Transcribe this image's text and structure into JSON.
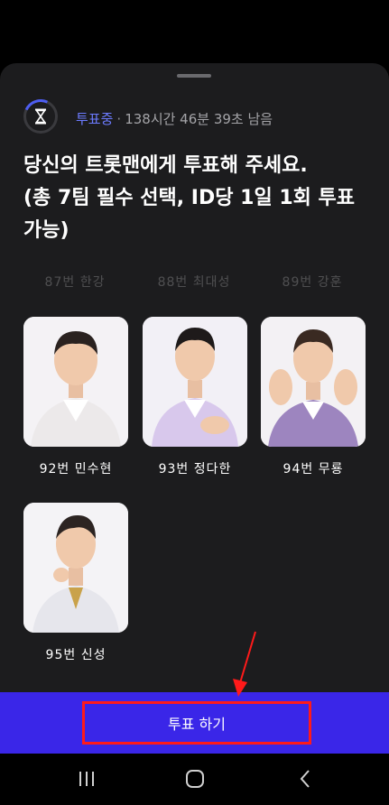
{
  "status": {
    "label": "투표중",
    "separator": "·",
    "remaining": "138시간 46분 39초 남음"
  },
  "title": "당신의 트롯맨에게 투표해 주세요.\n(총 7팀 필수 선택, ID당 1일 1회 투표\n가능)",
  "faded_labels": [
    "87번 한강",
    "88번 최대성",
    "89번 강훈"
  ],
  "candidates": [
    {
      "label": "92번 민수현",
      "jacket_color": "#ece9ea"
    },
    {
      "label": "93번 정다한",
      "jacket_color": "#d8c8ec"
    },
    {
      "label": "94번 무룡",
      "jacket_color": "#9d85bf"
    },
    {
      "label": "95번 신성",
      "jacket_color": "#e6e6ec"
    }
  ],
  "vote_button": {
    "label": "투표 하기"
  },
  "nav": {
    "recents_icon": "recents-icon",
    "home_icon": "home-icon",
    "back_icon": "back-icon"
  },
  "colors": {
    "accent": "#4d5df0",
    "vote_bar": "#3a26e8",
    "highlight": "#ff1a1a",
    "sheet": "#1c1c1e"
  }
}
